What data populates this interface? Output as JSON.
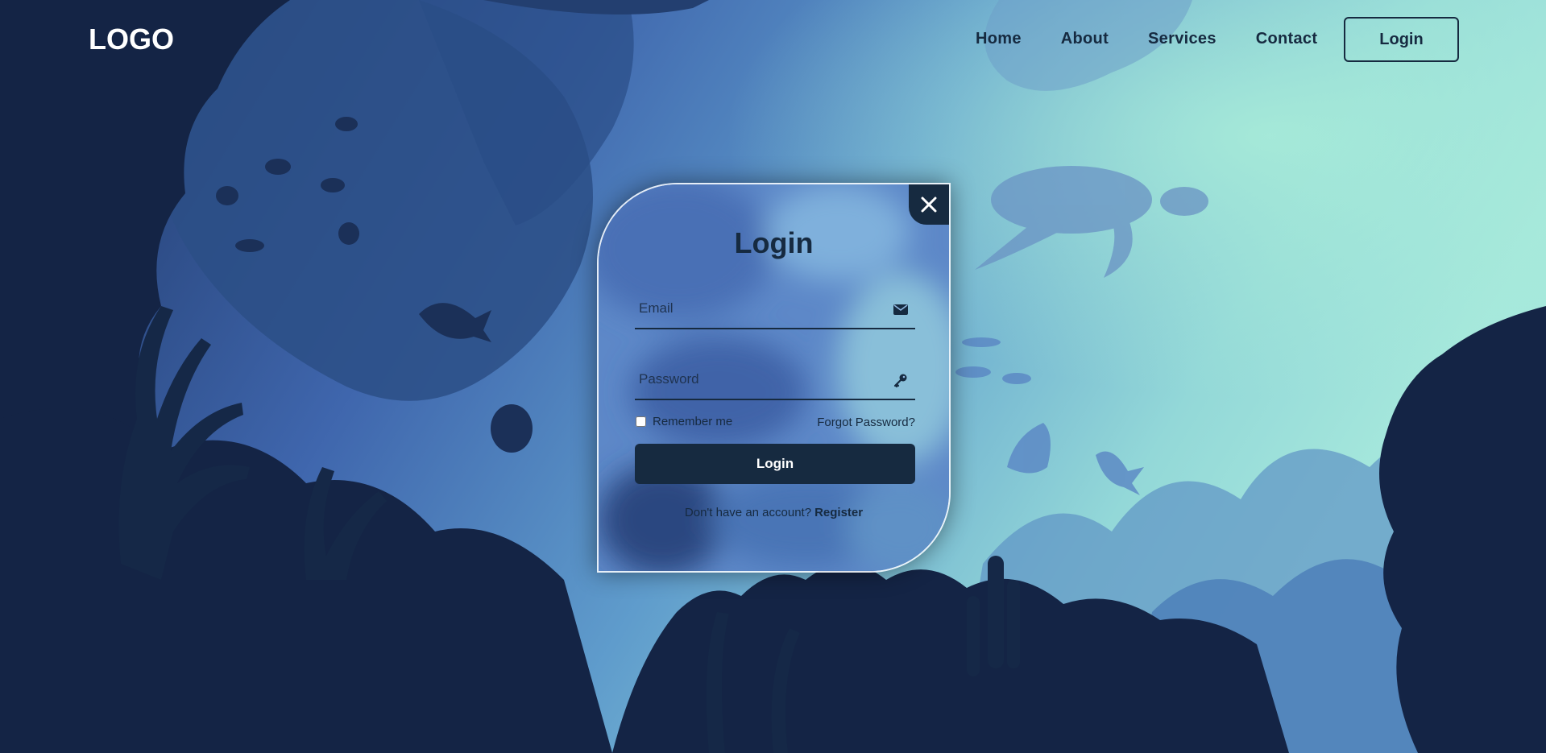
{
  "header": {
    "logo": "LOGO",
    "nav": [
      {
        "label": "Home",
        "name": "nav-home"
      },
      {
        "label": "About",
        "name": "nav-about"
      },
      {
        "label": "Services",
        "name": "nav-services"
      },
      {
        "label": "Contact",
        "name": "nav-contact"
      }
    ],
    "login_button": "Login"
  },
  "modal": {
    "title": "Login",
    "close_icon": "close-icon",
    "email": {
      "placeholder": "Email",
      "value": "",
      "icon": "mail-icon"
    },
    "password": {
      "placeholder": "Password",
      "value": "",
      "icon": "key-icon"
    },
    "remember_label": "Remember me",
    "remember_checked": false,
    "forgot_label": "Forgot Password?",
    "submit_label": "Login",
    "register_prompt": "Don't have an account?",
    "register_link": "Register"
  },
  "colors": {
    "dark_navy": "#162a40",
    "deep_background": "#132038",
    "mid_blue": "#4069b0",
    "aqua_glow": "#a2e9d8",
    "white": "#ffffff"
  }
}
